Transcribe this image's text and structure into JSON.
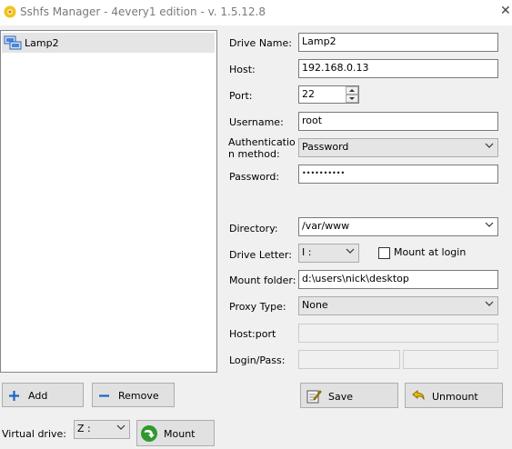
{
  "window": {
    "title": "Sshfs Manager - 4every1 edition - v. 1.5.12.8",
    "close_glyph": "✕"
  },
  "drives": [
    {
      "name": "Lamp2"
    }
  ],
  "form": {
    "drive_name": {
      "label": "Drive Name:",
      "value": "Lamp2"
    },
    "host": {
      "label": "Host:",
      "value": "192.168.0.13"
    },
    "port": {
      "label": "Port:",
      "value": "22"
    },
    "username": {
      "label": "Username:",
      "value": "root"
    },
    "auth_method": {
      "label_line1": "Authenticatio",
      "label_line2": "n method:",
      "value": "Password"
    },
    "password": {
      "label": "Password:",
      "value": "••••••••••"
    },
    "directory": {
      "label": "Directory:",
      "value": "/var/www"
    },
    "drive_letter": {
      "label": "Drive Letter:",
      "value": "I :"
    },
    "mount_at_login": {
      "label": "Mount at login",
      "checked": false
    },
    "mount_folder": {
      "label": "Mount folder:",
      "value": "d:\\users\\nick\\desktop"
    },
    "proxy_type": {
      "label": "Proxy Type:",
      "value": "None"
    },
    "host_port": {
      "label": "Host:port",
      "value": ""
    },
    "login_pass": {
      "label": "Login/Pass:",
      "login": "",
      "pass": ""
    }
  },
  "buttons": {
    "add": "Add",
    "remove": "Remove",
    "save": "Save",
    "unmount": "Unmount",
    "mount": "Mount"
  },
  "virtual_drive": {
    "label": "Virtual drive:",
    "value": "Z :"
  },
  "colors": {
    "accent_blue": "#1a66c7",
    "accent_green": "#2e9a2e",
    "list_selection": "#e5e5e5"
  }
}
